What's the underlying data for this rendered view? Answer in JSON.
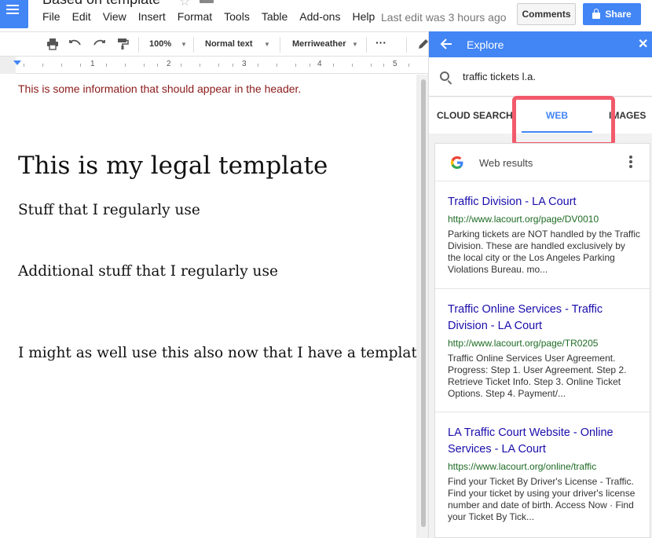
{
  "app": {
    "doc_title": "Based on template",
    "menus": [
      "File",
      "Edit",
      "View",
      "Insert",
      "Format",
      "Tools",
      "Table",
      "Add-ons",
      "Help"
    ],
    "last_edit": "Last edit was 3 hours ago",
    "comments_label": "Comments",
    "share_label": "Share"
  },
  "toolbar": {
    "zoom": "100%",
    "style": "Normal text",
    "font": "Merriweather",
    "more": "···"
  },
  "ruler": {
    "numbers": [
      "1",
      "2",
      "3",
      "4",
      "5"
    ]
  },
  "document": {
    "header_text": "This is some information that should appear in the header.",
    "heading": "This is my legal template",
    "paragraphs": [
      "Stuff that I regularly use",
      "Additional stuff that I regularly use",
      "I might as well use this also now that I have a template."
    ]
  },
  "explore": {
    "title": "Explore",
    "query": "traffic tickets l.a.",
    "tabs": [
      "CLOUD SEARCH",
      "WEB",
      "IMAGES"
    ],
    "active_tab": "WEB",
    "results_label": "Web results",
    "results": [
      {
        "title": "Traffic Division - LA Court",
        "url": "http://www.lacourt.org/page/DV0010",
        "snippet": "Parking tickets are NOT handled by the Traffic Division. These are handled exclusively by the local city or the Los Angeles Parking Violations Bureau. mo..."
      },
      {
        "title": "Traffic Online Services - Traffic Division - LA Court",
        "url": "http://www.lacourt.org/page/TR0205",
        "snippet": "Traffic Online Services User Agreement. Progress: Step 1. User Agreement. Step 2. Retrieve Ticket Info. Step 3. Online Ticket Options. Step 4. Payment/..."
      },
      {
        "title": "LA Traffic Court Website - Online Services - LA Court",
        "url": "https://www.lacourt.org/online/traffic",
        "snippet": "Find your Ticket By Driver's License - Traffic. Find your ticket by using your driver's license number and date of birth. Access Now · Find your Ticket By Tick..."
      }
    ]
  },
  "colors": {
    "accent": "#4285f4",
    "highlight": "#f25a6b",
    "header_text": "#8b1a1a",
    "link": "#1a0dab",
    "url": "#1e6b24"
  }
}
